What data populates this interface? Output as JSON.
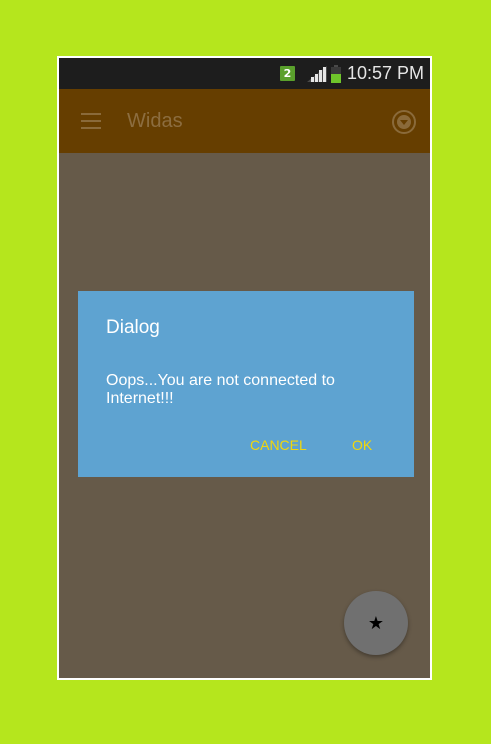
{
  "status_bar": {
    "sim_slot": "2",
    "time": "10:57 PM",
    "icons": [
      "sim-2-badge",
      "signal-icon",
      "battery-icon"
    ]
  },
  "toolbar": {
    "title": "Widas",
    "icons": [
      "menu-icon",
      "overflow-dropdown-icon"
    ]
  },
  "dialog": {
    "title": "Dialog",
    "message": "Oops...You are not connected to Internet!!!",
    "cancel_label": "CANCEL",
    "ok_label": "OK",
    "button_color": "#f2d70a",
    "background": "#5ea3d1"
  },
  "fab": {
    "icon": "star-icon",
    "glyph": "★"
  },
  "colors": {
    "page_background": "#b5e61d",
    "toolbar": "#663e00",
    "scrim_content": "#665a49"
  }
}
